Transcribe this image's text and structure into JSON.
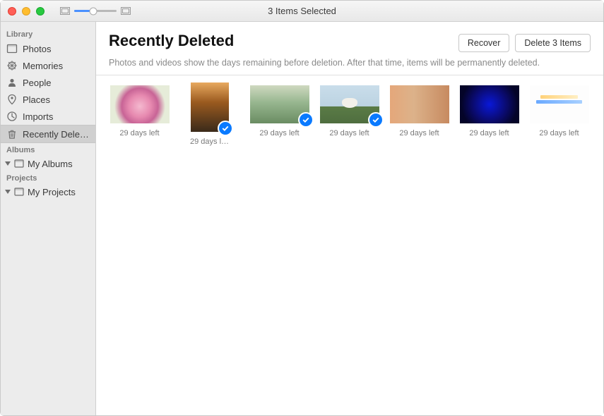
{
  "window": {
    "title": "3 Items Selected"
  },
  "sidebar": {
    "sections": [
      {
        "title": "Library",
        "items": [
          {
            "label": "Photos",
            "icon": "photos-icon"
          },
          {
            "label": "Memories",
            "icon": "memories-icon"
          },
          {
            "label": "People",
            "icon": "people-icon"
          },
          {
            "label": "Places",
            "icon": "places-icon"
          },
          {
            "label": "Imports",
            "icon": "imports-icon"
          },
          {
            "label": "Recently Dele…",
            "icon": "trash-icon",
            "active": true
          }
        ]
      },
      {
        "title": "Albums",
        "items": [
          {
            "label": "My Albums",
            "icon": "album-icon",
            "disclosure": true
          }
        ]
      },
      {
        "title": "Projects",
        "items": [
          {
            "label": "My Projects",
            "icon": "album-icon",
            "disclosure": true
          }
        ]
      }
    ]
  },
  "page": {
    "title": "Recently Deleted",
    "subtitle": "Photos and videos show the days remaining before deletion. After that time, items will be permanently deleted.",
    "actions": {
      "recover": "Recover",
      "delete": "Delete 3 Items"
    }
  },
  "grid": {
    "items": [
      {
        "days": "29 days left",
        "selected": false,
        "orient": "h",
        "thumb": "t1"
      },
      {
        "days": "29 days l…",
        "selected": true,
        "orient": "v",
        "thumb": "t2"
      },
      {
        "days": "29 days left",
        "selected": true,
        "orient": "h",
        "thumb": "t3"
      },
      {
        "days": "29 days left",
        "selected": true,
        "orient": "h",
        "thumb": "t4"
      },
      {
        "days": "29 days left",
        "selected": false,
        "orient": "h",
        "thumb": "t5"
      },
      {
        "days": "29 days left",
        "selected": false,
        "orient": "h",
        "thumb": "t6"
      },
      {
        "days": "29 days left",
        "selected": false,
        "orient": "h",
        "thumb": "t7"
      }
    ]
  }
}
